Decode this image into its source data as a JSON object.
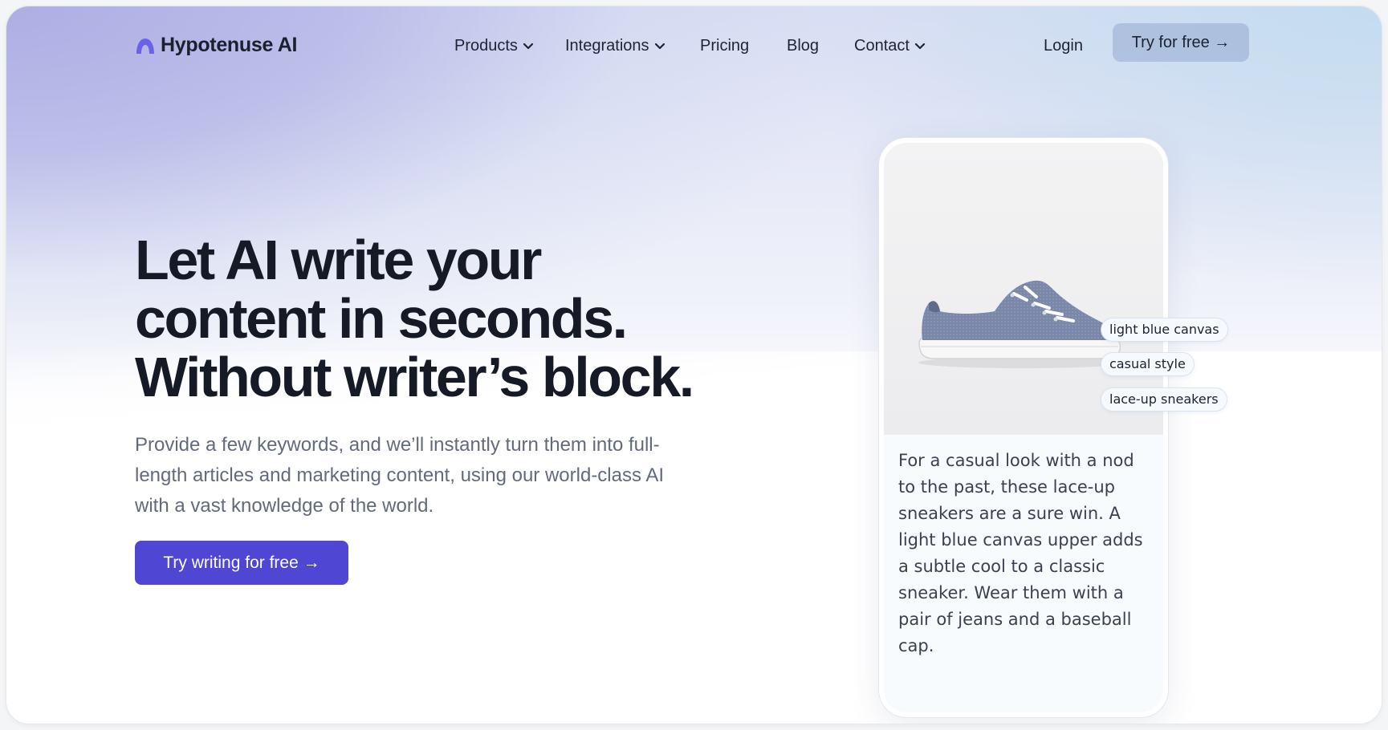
{
  "brand": {
    "name": "Hypotenuse AI",
    "accent": "#5046d4"
  },
  "nav": {
    "links": [
      {
        "label": "Products",
        "has_dropdown": true
      },
      {
        "label": "Integrations",
        "has_dropdown": true
      },
      {
        "label": "Pricing",
        "has_dropdown": false
      },
      {
        "label": "Blog",
        "has_dropdown": false
      },
      {
        "label": "Contact",
        "has_dropdown": true
      }
    ],
    "login": "Login",
    "cta": "Try for free →"
  },
  "hero": {
    "headline_lines": [
      "Let AI write your",
      "content in seconds.",
      "Without writer’s block."
    ],
    "subtext": "Provide a few keywords, and we’ll instantly turn them into full-length articles and marketing content, using our world-class AI with a vast knowledge of the world.",
    "cta": "Try writing for free →"
  },
  "demo": {
    "product_image": "sneaker-photo",
    "tags": [
      "light blue canvas",
      "casual style",
      "lace-up sneakers"
    ],
    "description": "For a casual look with a nod to the past, these lace-up sneakers are a sure win. A light blue canvas upper adds a subtle cool to a classic sneaker. Wear them with a pair of jeans and a baseball cap."
  }
}
